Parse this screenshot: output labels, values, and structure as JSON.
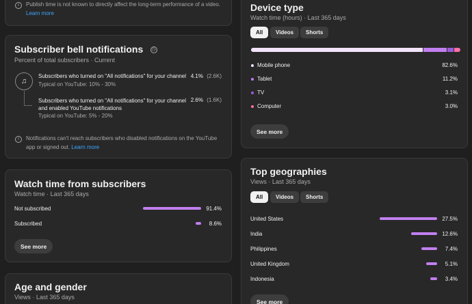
{
  "publish_card": {
    "text": "Publish time is not known to directly affect the long-term performance of a video.",
    "link": "Learn more"
  },
  "bell_card": {
    "title": "Subscriber bell notifications",
    "subtitle": "Percent of total subscribers · Current",
    "rows": [
      {
        "label": "Subscribers who turned on \"All notifications\" for your channel",
        "typical": "Typical on YouTube: 10% - 30%",
        "value": "4.1%",
        "count": "(2.6K)"
      },
      {
        "label": "Subscribers who turned on \"All notifications\" for your channel and enabled YouTube notifications",
        "typical": "Typical on YouTube: 5% - 20%",
        "value": "2.6%",
        "count": "(1.6K)"
      }
    ],
    "note": "Notifications can't reach subscribers who disabled notifications on the YouTube app or signed out.",
    "note_link": "Learn more"
  },
  "watch_card": {
    "title": "Watch time from subscribers",
    "subtitle": "Watch time · Last 365 days",
    "rows": [
      {
        "label": "Not subscribed",
        "value": "91.4%",
        "pct": 91.4
      },
      {
        "label": "Subscribed",
        "value": "8.6%",
        "pct": 8.6
      }
    ],
    "see_more": "See more"
  },
  "age_card": {
    "title": "Age and gender",
    "subtitle": "Views · Last 365 days"
  },
  "device_card": {
    "title": "Device type",
    "subtitle": "Watch time (hours) · Last 365 days",
    "tabs": [
      "All",
      "Videos",
      "Shorts"
    ],
    "rows": [
      {
        "label": "Mobile phone",
        "value": "82.6%",
        "pct": 82.6,
        "color": "#f3e4fb"
      },
      {
        "label": "Tablet",
        "value": "11.2%",
        "pct": 11.2,
        "color": "#c27ff0"
      },
      {
        "label": "TV",
        "value": "3.1%",
        "pct": 3.1,
        "color": "#9b5cd6"
      },
      {
        "label": "Computer",
        "value": "3.0%",
        "pct": 3.0,
        "color": "#ff6fa8"
      }
    ],
    "see_more": "See more"
  },
  "geo_card": {
    "title": "Top geographies",
    "subtitle": "Views · Last 365 days",
    "tabs": [
      "All",
      "Videos",
      "Shorts"
    ],
    "rows": [
      {
        "label": "United States",
        "value": "27.5%",
        "pct": 27.5
      },
      {
        "label": "India",
        "value": "12.6%",
        "pct": 12.6
      },
      {
        "label": "Philippines",
        "value": "7.4%",
        "pct": 7.4
      },
      {
        "label": "United Kingdom",
        "value": "5.1%",
        "pct": 5.1
      },
      {
        "label": "Indonesia",
        "value": "3.4%",
        "pct": 3.4
      }
    ],
    "see_more": "See more"
  }
}
